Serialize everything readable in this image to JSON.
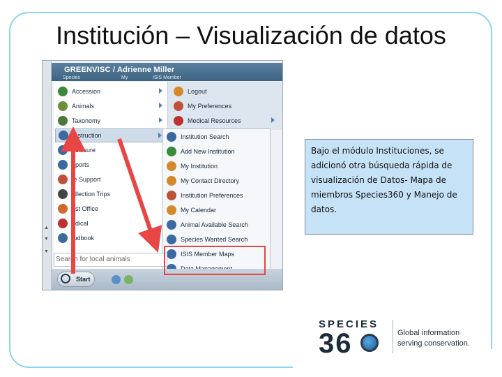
{
  "slide": {
    "title": "Institución – Visualización de datos",
    "note": "Bajo el módulo Instituciones, se adicionó otra búsqueda rápida de visualización de Datos- Mapa de miembros Species360 y Manejo de datos."
  },
  "app": {
    "header_title": "GREENVISC / Adrienne Miller",
    "header_sub": [
      "Species",
      "My",
      "ISIS Member"
    ],
    "left_menu": [
      {
        "label": "Accession",
        "icon": "plus-icon",
        "color": "#3a8a3a"
      },
      {
        "label": "Animals",
        "icon": "paw-icon",
        "color": "#6b8f3a"
      },
      {
        "label": "Taxonomy",
        "icon": "tree-icon",
        "color": "#4a7a3a"
      },
      {
        "label": "Instruction",
        "icon": "globe-icon",
        "color": "#3a6aa0"
      },
      {
        "label": "nclosure",
        "icon": "enclosure-icon",
        "color": "#3a6aa0"
      },
      {
        "label": "eports",
        "icon": "reports-icon",
        "color": "#3a6aa0"
      },
      {
        "label": "fe Support",
        "icon": "life-support-icon",
        "color": "#c0503a"
      },
      {
        "label": "ollection Trips",
        "icon": "collection-icon",
        "color": "#444"
      },
      {
        "label": "ost Office",
        "icon": "mail-icon",
        "color": "#d06a2a"
      },
      {
        "label": "edical",
        "icon": "medical-icon",
        "color": "#c03030"
      },
      {
        "label": "tudbook",
        "icon": "studbook-icon",
        "color": "#3a6aa0"
      }
    ],
    "right_menu": [
      {
        "label": "Logout",
        "icon": "key-icon",
        "color": "#d48a2a"
      },
      {
        "label": "My Preferences",
        "icon": "preferences-icon",
        "color": "#c0503a"
      },
      {
        "label": "Medical Resources",
        "icon": "medical-resources-icon",
        "color": "#c03030"
      }
    ],
    "submenu": [
      {
        "label": "Institution Search",
        "icon": "globe-icon",
        "color": "#3a6aa0"
      },
      {
        "label": "Add New Institution",
        "icon": "plus-icon",
        "color": "#3a8a3a"
      },
      {
        "label": "My Institution",
        "icon": "home-icon",
        "color": "#d48a2a"
      },
      {
        "label": "My Contact Directory",
        "icon": "contact-icon",
        "color": "#d48a2a"
      },
      {
        "label": "Institution Preferences",
        "icon": "preferences-icon",
        "color": "#c0503a"
      },
      {
        "label": "My Calendar",
        "icon": "calendar-icon",
        "color": "#d48a2a"
      },
      {
        "label": "Animal Available Search",
        "icon": "globe-icon",
        "color": "#3a6aa0"
      },
      {
        "label": "Species Wanted Search",
        "icon": "globe-icon",
        "color": "#3a6aa0"
      },
      {
        "label": "ISIS Member Maps",
        "icon": "map-icon",
        "color": "#3a6aa0"
      },
      {
        "label": "Data Management",
        "icon": "data-icon",
        "color": "#3a6aa0"
      }
    ],
    "search_placeholder": "Search for local animals",
    "start_label": "Start"
  },
  "logo": {
    "word1": "SPECIES",
    "word2": "36",
    "tagline1": "Global information",
    "tagline2": "serving conservation."
  }
}
